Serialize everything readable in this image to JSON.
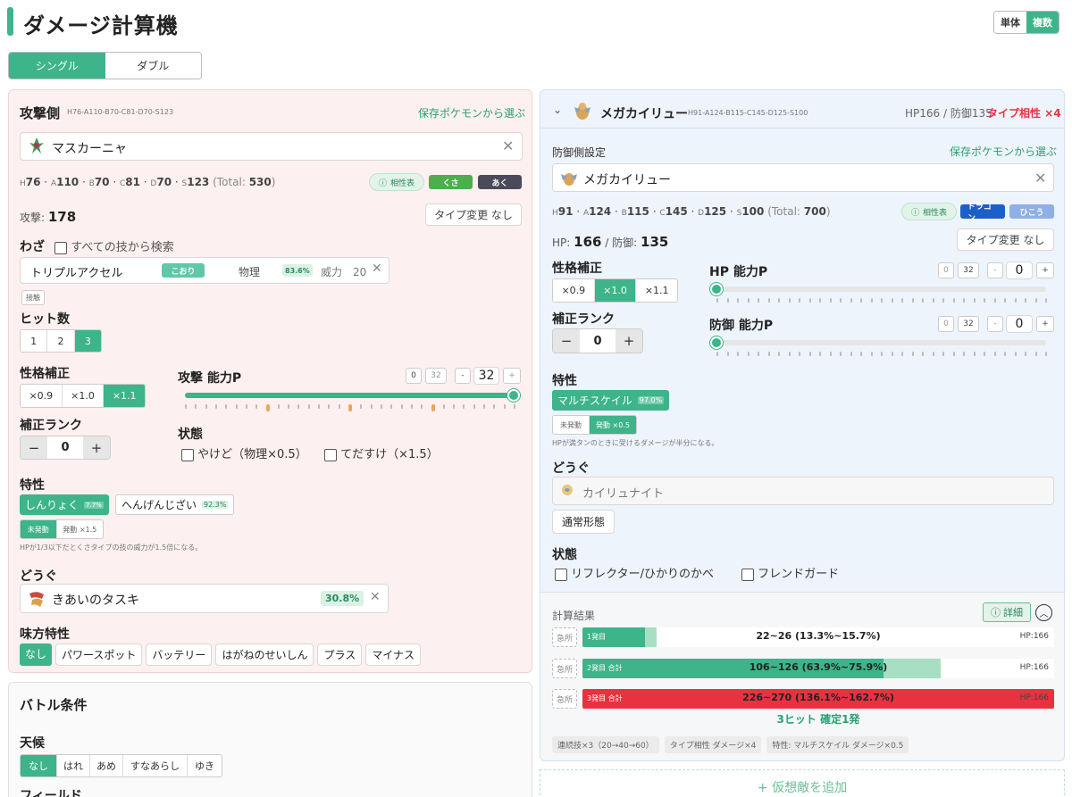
{
  "app": {
    "title": "ダメージ計算機",
    "mode": [
      "単体",
      "複数"
    ]
  },
  "battle_tabs": [
    "シングル",
    "ダブル"
  ],
  "attacker": {
    "header": "攻撃側",
    "base_stats_line": "H76-A110-B70-C81-D70-S123",
    "pick_saved": "保存ポケモンから選ぶ",
    "pokemon": "マスカーニャ",
    "stats": {
      "H": "H",
      "Hv": "76",
      "A": "A",
      "Av": "110",
      "B": "B",
      "Bv": "70",
      "C": "C",
      "Cv": "81",
      "D": "D",
      "Dv": "70",
      "S": "S",
      "Sv": "123",
      "total_label": "(Total:",
      "total": "530",
      ")": ")"
    },
    "type_chart": "相性表",
    "types": [
      "くさ",
      "あく"
    ],
    "attack_label": "攻撃:",
    "attack_value": "178",
    "type_change": "タイプ変更 なし",
    "move_header": "わざ",
    "search_all": "すべての技から検索",
    "move": {
      "name": "トリプルアクセル",
      "type": "こおり",
      "category": "物理",
      "usage": "83.6%",
      "power_label": "威力",
      "power": "20"
    },
    "contact": "接触",
    "hits_header": "ヒット数",
    "hits": [
      "1",
      "2",
      "3"
    ],
    "nature_header": "性格補正",
    "nature": [
      "×0.9",
      "×1.0",
      "×1.1"
    ],
    "ev_header": "攻撃 能力P",
    "ev": {
      "zero": "0",
      "max": "32",
      "minus": "-",
      "value": "32",
      "plus": "+",
      "fraction": 1.0
    },
    "rank_header": "補正ランク",
    "rank": {
      "minus": "−",
      "value": "0",
      "plus": "+"
    },
    "status_header": "状態",
    "status": [
      "やけど（物理×0.5）",
      "てだすけ（×1.5）"
    ],
    "ability_header": "特性",
    "abilities": [
      {
        "name": "しんりょく",
        "pct": "7.7%"
      },
      {
        "name": "へんげんじざい",
        "pct": "92.3%"
      }
    ],
    "activation": [
      "未発動",
      "発動 ×1.5"
    ],
    "ability_note": "HPが1/3以下だとくさタイプの技の威力が1.5倍になる。",
    "item_header": "どうぐ",
    "item": {
      "name": "きあいのタスキ",
      "pct": "30.8%"
    },
    "ally_header": "味方特性",
    "ally": [
      "なし",
      "パワースポット",
      "バッテリー",
      "はがねのせいしん",
      "プラス",
      "マイナス"
    ]
  },
  "battle": {
    "header": "バトル条件",
    "weather_header": "天候",
    "weather": [
      "なし",
      "はれ",
      "あめ",
      "すなあらし",
      "ゆき"
    ],
    "field_header": "フィールド"
  },
  "defender": {
    "name": "メガカイリュー",
    "base_stats_line": "H91-A124-B115-C145-D125-S100",
    "summary": "HP166 / 防御135",
    "effectiveness": "タイプ相性 ×4",
    "settings_header": "防御側設定",
    "pick_saved": "保存ポケモンから選ぶ",
    "pokemon": "メガカイリュー",
    "stats": {
      "H": "H",
      "Hv": "91",
      "A": "A",
      "Av": "124",
      "B": "B",
      "Bv": "115",
      "C": "C",
      "Cv": "145",
      "D": "D",
      "Dv": "125",
      "S": "S",
      "Sv": "100",
      "total_label": "(Total:",
      "total": "700",
      ")": ")"
    },
    "type_chart": "相性表",
    "types": [
      "ドラゴン",
      "ひこう"
    ],
    "hp_label": "HP:",
    "hp": "166",
    "def_label": "/ 防御:",
    "def": "135",
    "type_change": "タイプ変更 なし",
    "nature_header": "性格補正",
    "nature": [
      "×0.9",
      "×1.0",
      "×1.1"
    ],
    "hp_ev_header": "HP 能力P",
    "def_ev_header": "防御 能力P",
    "ev": {
      "zero": "0",
      "max": "32",
      "minus": "-",
      "value": "0",
      "plus": "+",
      "fraction": 0.0
    },
    "rank_header": "補正ランク",
    "rank": {
      "minus": "−",
      "value": "0",
      "plus": "+"
    },
    "ability_header": "特性",
    "ability": {
      "name": "マルチスケイル",
      "pct": "97.0%"
    },
    "activation": [
      "未発動",
      "発動 ×0.5"
    ],
    "ability_note": "HPが満タンのときに受けるダメージが半分になる。",
    "item_header": "どうぐ",
    "item": "カイリュナイト",
    "form": "通常形態",
    "status_header": "状態",
    "status": [
      "リフレクター/ひかりのかべ",
      "フレンドガード"
    ]
  },
  "results": {
    "header": "計算結果",
    "details": "詳細",
    "crit": "急所",
    "rows": [
      {
        "label": "1発目",
        "value": "22~26 (13.3%~15.7%)",
        "hp": "HP:166",
        "min": 0.133,
        "max": 0.157
      },
      {
        "label": "2発目 合計",
        "value": "106~126 (63.9%~75.9%)",
        "hp": "HP:166",
        "min": 0.639,
        "max": 0.759
      },
      {
        "label": "3発目 合計",
        "value": "226~270 (136.1%~162.7%)",
        "hp": "HP:166",
        "min": 1.0,
        "max": 1.0
      }
    ],
    "verdict": "3ヒット 確定1発",
    "tags": [
      "連続技×3（20→40→60）",
      "タイプ相性 ダメージ×4",
      "特性: マルチスケイル ダメージ×0.5"
    ],
    "add_enemy": "+ 仮想敵を追加"
  },
  "colors": {
    "accent": "#3db48a",
    "danger": "#e8323f",
    "ice": "#5fc8a8",
    "grass": "#4cae4c",
    "dark": "#4a4a5a",
    "dragon": "#1c5fc8",
    "flying": "#8fb0e6"
  }
}
